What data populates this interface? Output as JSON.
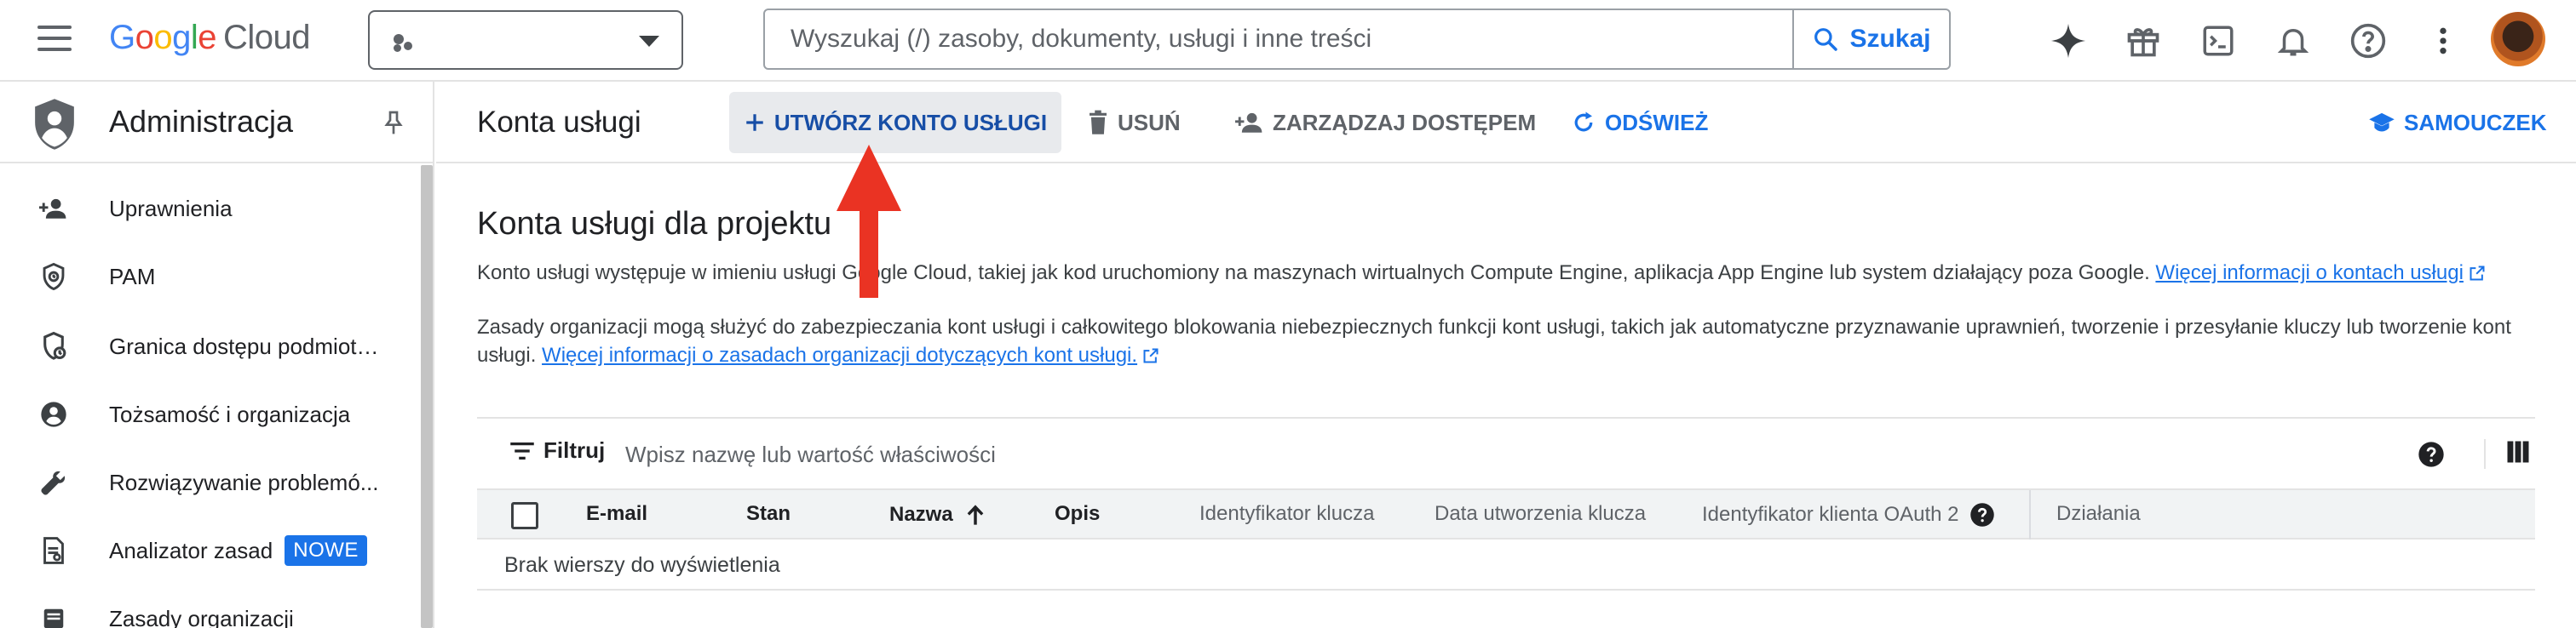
{
  "header": {
    "logo_google": "Google",
    "logo_cloud": "Cloud",
    "search_placeholder": "Wyszukaj (/) zasoby, dokumenty, usługi i inne treści",
    "search_button": "Szukaj",
    "icons": [
      "gemini-icon",
      "gift-icon",
      "cloud-shell-icon",
      "notifications-icon",
      "help-icon",
      "more-vert-icon"
    ]
  },
  "sidebar": {
    "title": "Administracja",
    "items": [
      {
        "label": "Uprawnienia",
        "icon": "person-add-icon"
      },
      {
        "label": "PAM",
        "icon": "shield-clock-icon"
      },
      {
        "label": "Granica dostępu podmiotu...",
        "icon": "boundary-shield-icon"
      },
      {
        "label": "Tożsamość i organizacja",
        "icon": "account-circle-icon"
      },
      {
        "label": "Rozwiązywanie problemó...",
        "icon": "wrench-icon"
      },
      {
        "label": "Analizator zasad",
        "icon": "policy-doc-icon",
        "badge": "NOWE"
      },
      {
        "label": "Zasady organizacji",
        "icon": "list-icon"
      }
    ]
  },
  "toolbar": {
    "page_title": "Konta usługi",
    "create_label": "UTWÓRZ KONTO USŁUGI",
    "delete_label": "USUŃ",
    "manage_access_label": "ZARZĄDZAJ DOSTĘPEM",
    "refresh_label": "ODŚWIEŻ",
    "tutorial_label": "SAMOUCZEK"
  },
  "main": {
    "heading": "Konta usługi dla projektu",
    "para1_text": "Konto usługi występuje w imieniu usługi Google Cloud, takiej jak kod uruchomiony na maszynach wirtualnych Compute Engine, aplikacja App Engine lub system działający poza Google.",
    "para1_link": "Więcej informacji o kontach usługi",
    "para2_text": "Zasady organizacji mogą służyć do zabezpieczania kont usługi i całkowitego blokowania niebezpiecznych funkcji kont usługi, takich jak automatyczne przyznawanie uprawnień, tworzenie i przesyłanie kluczy lub tworzenie kont usługi.",
    "para2_link": "Więcej informacji o zasadach organizacji dotyczących kont usługi."
  },
  "table": {
    "filter_label": "Filtruj",
    "filter_placeholder": "Wpisz nazwę lub wartość właściwości",
    "columns": [
      "E-mail",
      "Stan",
      "Nazwa",
      "Opis",
      "Identyfikator klucza",
      "Data utworzenia klucza",
      "Identyfikator klienta OAuth 2",
      "Działania"
    ],
    "empty_message": "Brak wierszy do wyświetlenia"
  },
  "colors": {
    "accent": "#1a73e8",
    "annotation_arrow": "#ea3323"
  }
}
